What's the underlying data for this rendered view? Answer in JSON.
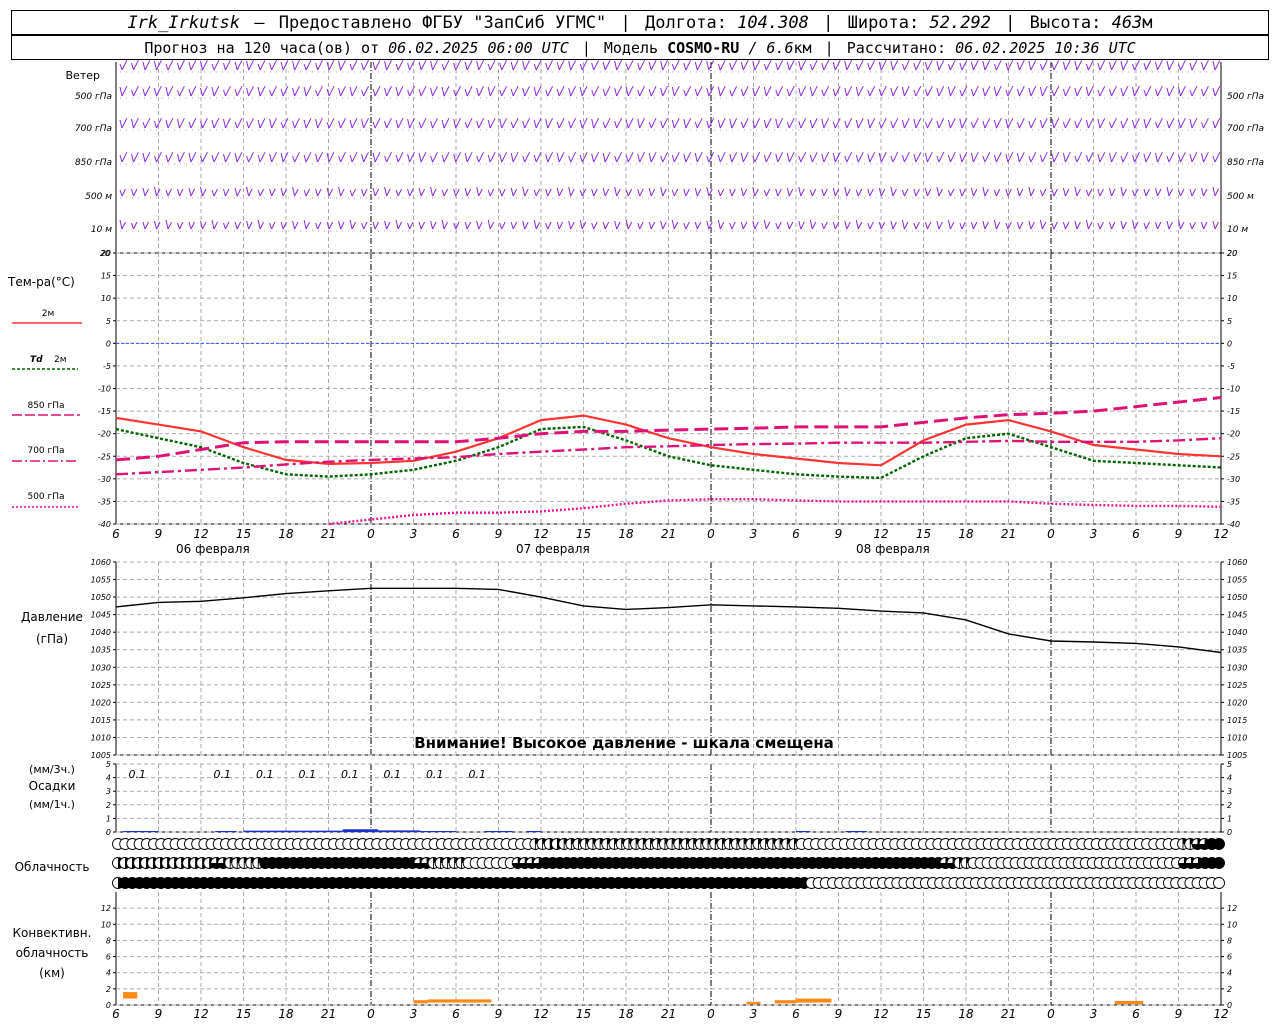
{
  "header": {
    "station": "Irk_Irkutsk",
    "dash": "—",
    "provider": "Предоставлено ФГБУ \"ЗапСиб УГМС\"",
    "lon_label": "Долгота:",
    "lon_value": "104.308",
    "lat_label": "Широта:",
    "lat_value": "52.292",
    "alt_label": "Высота:",
    "alt_value": "463",
    "alt_unit": "м",
    "forecast_label": "Прогноз на 120 часа(ов) от",
    "forecast_start": "06.02.2025 06:00 UTC",
    "model_label": "Модель",
    "model_name": "COSMO-RU",
    "model_res": "/ 6.6",
    "model_res_unit": "км",
    "computed_label": "Рассчитано:",
    "computed_value": "06.02.2025 10:36 UTC"
  },
  "colors": {
    "wind": "#8a2be2",
    "t2m": "#ff3333",
    "td2m": "#006400",
    "t850": "#dd1177",
    "t700": "#dd1177",
    "t500": "#ee1199",
    "zero_line": "#3355ff",
    "pressure": "#000000",
    "precip": "#1a2fd0",
    "conv": "#ff8a1a",
    "grid": "#aaaaaa"
  },
  "wind_panel": {
    "title": "Ветер",
    "levels": [
      "500 гПа",
      "700 гПа",
      "850 гПа",
      "500 м",
      "10  м"
    ],
    "bottom_label": "20"
  },
  "time_axis": {
    "hour_ticks": [
      "6",
      "9",
      "12",
      "15",
      "18",
      "21",
      "0",
      "3",
      "6",
      "9",
      "12",
      "15",
      "18",
      "21",
      "0",
      "3",
      "6",
      "9",
      "12",
      "15",
      "18",
      "21",
      "0",
      "3",
      "6",
      "9",
      "12"
    ],
    "day_labels": [
      "06 февраля",
      "07 февраля",
      "08 февраля"
    ]
  },
  "chart_data": [
    {
      "type": "line",
      "title": "Тем-ра(°C)",
      "x_hours": [
        0,
        3,
        6,
        9,
        12,
        15,
        18,
        21,
        24,
        27,
        30,
        33,
        36,
        39,
        42,
        45,
        48,
        51,
        54,
        57,
        60,
        63,
        66,
        69,
        72,
        75,
        78
      ],
      "ylim": [
        -40,
        20
      ],
      "yticks": [
        20,
        15,
        10,
        5,
        0,
        -5,
        -10,
        -15,
        -20,
        -25,
        -30,
        -35,
        -40
      ],
      "series": [
        {
          "name": "2м",
          "values": [
            -16.5,
            -18,
            -19.5,
            -23,
            -25.8,
            -26.7,
            -26.5,
            -26,
            -24,
            -21,
            -17,
            -16,
            -18,
            -21,
            -23,
            -24.5,
            -25.5,
            -26.5,
            -27,
            -21.5,
            -18,
            -17,
            -19.5,
            -22.5,
            -23.5,
            -24.5,
            -25
          ]
        },
        {
          "name": "Td 2м",
          "values": [
            -19,
            -21,
            -23,
            -26.5,
            -29,
            -29.5,
            -29,
            -28,
            -26,
            -23,
            -19,
            -18.5,
            -21.5,
            -25,
            -27,
            -28,
            -29,
            -29.5,
            -29.8,
            -25,
            -21,
            -20,
            -23,
            -26,
            -26.5,
            -27,
            -27.5
          ]
        },
        {
          "name": "850 гПа",
          "values": [
            -25.8,
            -25,
            -23.5,
            -22,
            -21.8,
            -21.8,
            -21.8,
            -21.8,
            -21.8,
            -21,
            -20,
            -19.5,
            -19.5,
            -19.2,
            -19,
            -18.8,
            -18.5,
            -18.5,
            -18.5,
            -17.5,
            -16.5,
            -15.8,
            -15.5,
            -15,
            -14,
            -13,
            -12
          ]
        },
        {
          "name": "700 гПа",
          "values": [
            -29,
            -28.5,
            -28,
            -27.5,
            -26.8,
            -26.2,
            -25.8,
            -25.5,
            -25.2,
            -24.5,
            -24,
            -23.5,
            -23,
            -22.8,
            -22.5,
            -22.3,
            -22.2,
            -22,
            -22,
            -22,
            -21.8,
            -21.6,
            -21.8,
            -21.8,
            -21.8,
            -21.5,
            -21
          ]
        },
        {
          "name": "500 гПа",
          "values": [
            null,
            null,
            null,
            null,
            null,
            -40,
            -39,
            -38,
            -37.5,
            -37.5,
            -37.2,
            -36.5,
            -35.5,
            -34.8,
            -34.5,
            -34.5,
            -34.8,
            -35,
            -35,
            -35,
            -35,
            -35,
            -35.5,
            -35.8,
            -36,
            -36,
            -36.2
          ]
        }
      ]
    },
    {
      "type": "line",
      "title": "Давление",
      "unit": "(гПа)",
      "x_hours": [
        0,
        3,
        6,
        9,
        12,
        15,
        18,
        21,
        24,
        27,
        30,
        33,
        36,
        39,
        42,
        45,
        48,
        51,
        54,
        57,
        60,
        63,
        66,
        69,
        72,
        75,
        78
      ],
      "ylim": [
        1005,
        1060
      ],
      "yticks": [
        1060,
        1055,
        1050,
        1045,
        1040,
        1035,
        1030,
        1025,
        1020,
        1015,
        1010,
        1005
      ],
      "series": [
        {
          "name": "",
          "values": [
            1047.2,
            1048.5,
            1048.8,
            1049.8,
            1051,
            1051.8,
            1052.5,
            1052.5,
            1052.5,
            1052.2,
            1050,
            1047.5,
            1046.5,
            1047,
            1047.8,
            1047.5,
            1047.2,
            1046.8,
            1046,
            1045.5,
            1043.5,
            1039.5,
            1037.5,
            1037.2,
            1036.8,
            1035.8,
            1034.2
          ]
        }
      ]
    },
    {
      "type": "bar",
      "title": "Осадки",
      "units": [
        "(мм/3ч.)",
        "(мм/1ч.)"
      ],
      "ylim": [
        0,
        5
      ],
      "yticks": [
        5,
        4,
        3,
        2,
        1,
        0
      ],
      "labels": [
        "0.1",
        "0.1",
        "0.1",
        "0.1",
        "0.1",
        "0.1",
        "0.1",
        "0.1"
      ],
      "label_hours": [
        1.5,
        7.5,
        10.5,
        13.5,
        16.5,
        19.5,
        22.5,
        25.5
      ],
      "bars": [
        {
          "x_start": 0.5,
          "x_end": 3.0,
          "value": 0.06
        },
        {
          "x_start": 7.0,
          "x_end": 8.5,
          "value": 0.06
        },
        {
          "x_start": 9.0,
          "x_end": 13.0,
          "value": 0.1
        },
        {
          "x_start": 13.0,
          "x_end": 16.0,
          "value": 0.1
        },
        {
          "x_start": 16.0,
          "x_end": 18.5,
          "value": 0.2
        },
        {
          "x_start": 18.5,
          "x_end": 21.5,
          "value": 0.12
        },
        {
          "x_start": 21.5,
          "x_end": 24.0,
          "value": 0.06
        },
        {
          "x_start": 26.0,
          "x_end": 28.0,
          "value": 0.06
        },
        {
          "x_start": 29.0,
          "x_end": 30.0,
          "value": 0.05
        },
        {
          "x_start": 48.0,
          "x_end": 49.0,
          "value": 0.05
        },
        {
          "x_start": 51.5,
          "x_end": 53.0,
          "value": 0.05
        }
      ]
    },
    {
      "type": "bar",
      "title": "Конвективн. облачность",
      "unit": "(км)",
      "ylim": [
        0,
        14
      ],
      "yticks": [
        12,
        10,
        8,
        6,
        4,
        2,
        0
      ],
      "bars": [
        {
          "x_start": 0.5,
          "x_end": 1.5,
          "base": 0.8,
          "top": 1.6
        },
        {
          "x_start": 21.0,
          "x_end": 22.0,
          "base": 0.2,
          "top": 0.6
        },
        {
          "x_start": 22.0,
          "x_end": 26.5,
          "base": 0.3,
          "top": 0.7
        },
        {
          "x_start": 44.5,
          "x_end": 45.5,
          "base": 0.1,
          "top": 0.4
        },
        {
          "x_start": 46.5,
          "x_end": 48.0,
          "base": 0.2,
          "top": 0.6
        },
        {
          "x_start": 48.0,
          "x_end": 50.5,
          "base": 0.3,
          "top": 0.8
        },
        {
          "x_start": 70.5,
          "x_end": 72.5,
          "base": 0.1,
          "top": 0.5
        }
      ]
    }
  ],
  "temp_legend": [
    "2м",
    "Td",
    "2м",
    "850 гПа",
    "700 гПа",
    "500 гПа"
  ],
  "pressure_warning": "Внимание! Высокое давление - шкала смещена",
  "cloud_panel": {
    "title": "Облачность",
    "rows": [
      "OOOOOOOOOOOOOOOOOOOOOOOOOOOOOOOOOOOOOOOOOOOOOOOOOOOOOOOOOOQQHHQQQQQQQQQQQQQQQQQQQQQQQQQQQQQQQQQOOOOOOOOOOOOOOOOOOOOOOOOOOOOOOOOOOOOOOOOOOOOOOOOOOOOOQQTTFF",
      "HHHHHHHHHHHHHHTTQQQQQFFFFFFFFFFFFFFFFFFFFFFTTQQQQQOOOOOOOTTTTFFFFFFFFFFFFFFFFFFFFFFFFFFFFFFFFFFFFFFFFFFFFFFFFFFFFFFFFFTTQQOOOOOOOOOOOOOOOOOOOOOOOOOOOOOOTTTFFF",
      "HFFFFFFFFFFFFFFFFFFFFFFFFFFFFFFFFFFFFFFFFFFFFFFFFFFFFFFFFFFFFFFFFFFFFFFFFFFFFFFFFFFFFFFFFFFFFFFFFOOOOOOOOOOOOOOOOOOOOOOOOOOOOOOOOOOOOOOOOOOOOOOOOOOOOOOOOOO"
    ]
  }
}
